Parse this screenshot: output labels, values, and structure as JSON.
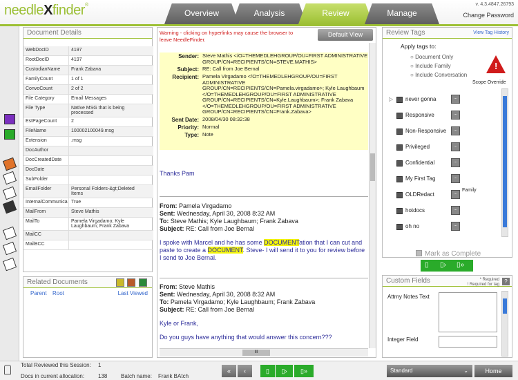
{
  "header": {
    "logo_left": "needle",
    "logo_x": "X",
    "logo_right": "finder",
    "logo_tm": "®",
    "version": "v. 4.3.4847.26793",
    "change_password": "Change Password",
    "tabs": [
      {
        "label": "Overview",
        "active": false
      },
      {
        "label": "Analysis",
        "active": false
      },
      {
        "label": "Review",
        "active": true
      },
      {
        "label": "Manage",
        "active": false
      }
    ]
  },
  "colors": {
    "accent": "#9dc034",
    "warning": "#d01b1b",
    "header_bg": "#ffffc4",
    "highlight": "#f4f50a",
    "nav_green": "#2aab2a"
  },
  "document_details": {
    "title": "Document Details",
    "rows": [
      {
        "k": "WebDocID",
        "v": "4197"
      },
      {
        "k": "RootDocID",
        "v": "4197"
      },
      {
        "k": "CustodianName",
        "v": "Frank Zabava"
      },
      {
        "k": "FamilyCount",
        "v": "1 of 1"
      },
      {
        "k": "ConvoCount",
        "v": "2 of 2"
      },
      {
        "k": "File Category",
        "v": "Email Messages"
      },
      {
        "k": "File Type",
        "v": "Native MSG that is being processed"
      },
      {
        "k": "EstPageCount",
        "v": "2"
      },
      {
        "k": "FileName",
        "v": "100002100049.msg"
      },
      {
        "k": "Extension",
        "v": ".msg"
      },
      {
        "k": "DocAuthor",
        "v": ""
      },
      {
        "k": "DocCreatedDate",
        "v": ""
      },
      {
        "k": "DocDate",
        "v": ""
      },
      {
        "k": "SubFolder",
        "v": ""
      },
      {
        "k": "EmailFolder",
        "v": "Personal Folders-&gt;Deleted Items"
      },
      {
        "k": "InternalCommunica",
        "v": "True"
      },
      {
        "k": "MailFrom",
        "v": "Steve Mathis"
      },
      {
        "k": "MailTo",
        "v": "Pamela Virgadamo; Kyle Laughbaum; Frank Zabava"
      },
      {
        "k": "MailCC",
        "v": ""
      },
      {
        "k": "MailBCC",
        "v": ""
      }
    ]
  },
  "related_documents": {
    "title": "Related Documents",
    "col_parent": "Parent",
    "col_root": "Root",
    "last_viewed": "Last Viewed"
  },
  "viewer": {
    "warning": "Warning - clicking on hyperlinks may cause the browser to leave NeedleFinder.",
    "default_view": "Default View",
    "fields": [
      {
        "k": "Sender:",
        "v": "Steve Mathis </O=THEMEDLEHGROUP/OU=FIRST ADMINISTRATIVE GROUP/CN=RECIPIENTS/CN=STEVE.MATHIS>"
      },
      {
        "k": "Subject:",
        "v": "RE: Call from Joe Bernal"
      },
      {
        "k": "Recipient:",
        "v": "Pamela Virgadamo </O=THEMEDLEHGROUP/OU=FIRST ADMINISTRATIVE GROUP/CN=RECIPIENTS/CN=Pamela.virgadamo>; Kyle Laughbaum </O=THEMEDLEHGROUP/OU=FIRST ADMINISTRATIVE GROUP/CN=RECIPIENTS/CN=Kyle.Laughbaum>; Frank Zabava </O=THEMEDLEHGROUP/OU=FIRST ADMINISTRATIVE GROUP/CN=RECIPIENTS/CN=Frank.Zabava>"
      },
      {
        "k": "Sent Date:",
        "v": "2008/04/30 08:32:38"
      },
      {
        "k": "Priority:",
        "v": "Normal"
      },
      {
        "k": "Type:",
        "v": "Note"
      }
    ],
    "thanks": "Thanks Pam",
    "msg1": {
      "from_k": "From:",
      "from_v": "Pamela Virgadamo",
      "sent_k": "Sent:",
      "sent_v": "Wednesday, April 30, 2008 8:32 AM",
      "to_k": "To:",
      "to_v": "Steve Mathis; Kyle Laughbaum; Frank Zabava",
      "subj_k": "Subject:",
      "subj_v": "RE: Call from Joe Bernal",
      "p1": "I spoke with Marcel and he has some ",
      "hl1": "DOCUMENT",
      "p2": "ation that I can cut and paste to create a ",
      "hl2": "DOCUMENT",
      "p3": ".  Steve- I will send it to you for review before I send to Joe Bernal."
    },
    "msg2": {
      "from_k": "From:",
      "from_v": "Steve Mathis",
      "sent_k": "Sent:",
      "sent_v": "Wednesday, April 30, 2008 8:32 AM",
      "to_k": "To:",
      "to_v": "Pamela  Virgadamo; Kyle Laughbaum; Frank Zabava",
      "subj_k": "Subject:",
      "subj_v": "RE: Call from Joe Bernal",
      "greet": "Kyle or Frank,",
      "body": "Do you guys have anything that would answer this concern???"
    },
    "hscroll_mark": "III"
  },
  "review_tags": {
    "title": "Review Tags",
    "history": "View Tag History",
    "apply_to": "Apply tags to:",
    "options": [
      "Document Only",
      "Include Family",
      "Include Conversation"
    ],
    "scope_override": "Scope Override",
    "tags": [
      "never gonna",
      "Responsive",
      "Non-Responsive",
      "Privileged",
      "Confidential",
      "My First Tag",
      "OLDRedact",
      "hotdocs",
      "oh no"
    ],
    "family_label": "Family",
    "mark_complete": "Mark as Complete"
  },
  "custom_fields": {
    "title": "Custom Fields",
    "req1": "* Required",
    "req2": "! Required for tag",
    "f1": "Attrny Notes Text",
    "f2": "Integer Field"
  },
  "status": {
    "reviewed_label": "Total Reviewed this Session:",
    "reviewed_value": "1",
    "docs_label": "Docs in current allocation:",
    "docs_value": "138",
    "batch_label": "Batch name:",
    "batch_value": "Frank BAtch",
    "standard": "Standard",
    "home": "Home"
  }
}
